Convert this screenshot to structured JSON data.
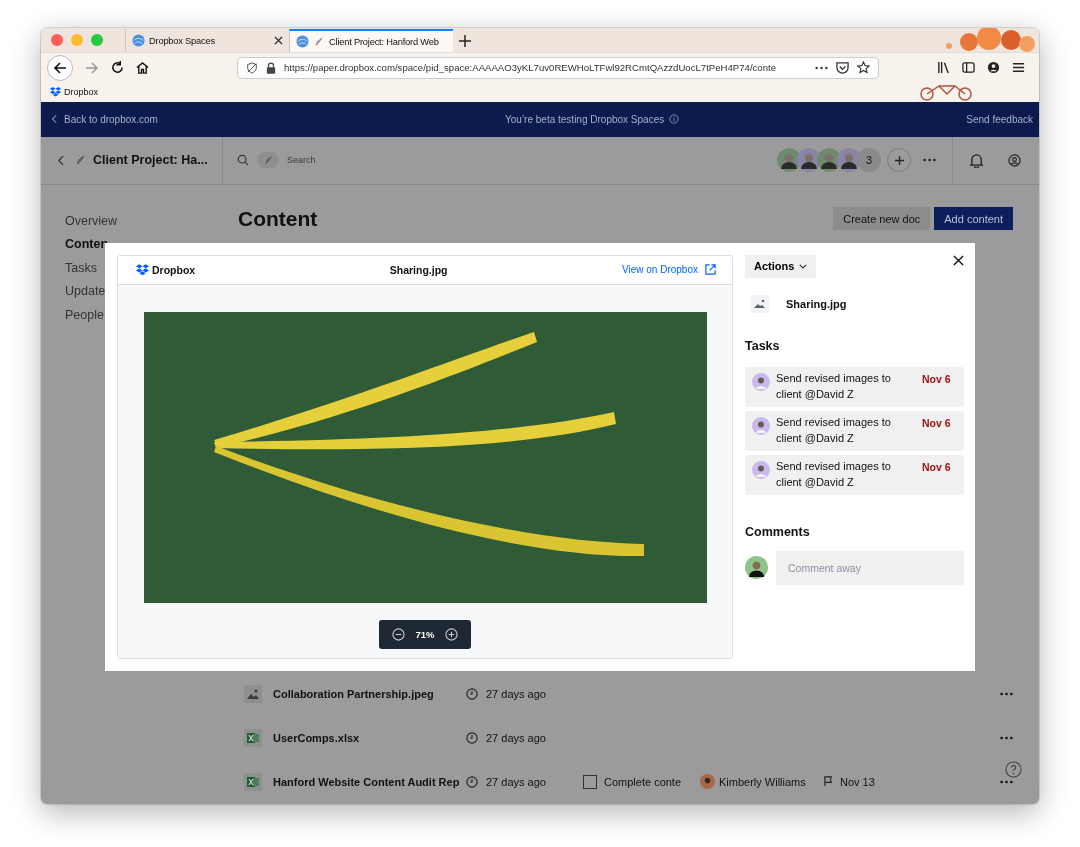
{
  "browser": {
    "tabs": [
      {
        "title": "Dropbox Spaces",
        "selected": false
      },
      {
        "title": "Client Project: Hanford Web",
        "selected": true
      }
    ],
    "url": "https://paper.dropbox.com/space/pid_space:AAAAAO3yKL7uv0REWHoLTFwl92RCmtQAzzdUocL7tPeH4P74/conte",
    "bookmarks": [
      "Dropbox"
    ]
  },
  "banner": {
    "back": "Back to dropbox.com",
    "message": "You’re beta testing Dropbox Spaces",
    "feedback": "Send feedback"
  },
  "header": {
    "title": "Client Project: Ha...",
    "search": {
      "placeholder": "Search"
    },
    "member_count": "3"
  },
  "sidebar": {
    "items": [
      {
        "label": "Overview",
        "selected": false
      },
      {
        "label": "Conten",
        "selected": true
      },
      {
        "label": "Tasks",
        "selected": false
      },
      {
        "label": "Update",
        "selected": false
      },
      {
        "label": "People",
        "selected": false
      }
    ]
  },
  "content": {
    "title": "Content",
    "buttons": [
      {
        "label": "Create new doc",
        "kind": "secondary"
      },
      {
        "label": "Add content",
        "kind": "primary"
      }
    ],
    "rows": [
      {
        "kind": "image",
        "name": "Collaboration Partnership.jpeg",
        "modified": "27 days ago"
      },
      {
        "kind": "sheet",
        "name": "UserComps.xlsx",
        "modified": "27 days ago"
      },
      {
        "kind": "sheet",
        "name": "Hanford Website Content Audit Rep",
        "modified": "27 days ago",
        "task": {
          "label": "Complete conte",
          "checked": false
        },
        "assignee": "Kimberly Williams",
        "due": "Nov 13"
      }
    ]
  },
  "preview": {
    "brand": "Dropbox",
    "file_name": "Sharing.jpg",
    "link": "View on Dropbox",
    "zoom": "71%"
  },
  "details": {
    "actions": "Actions",
    "file_name": "Sharing.jpg",
    "tasks_heading": "Tasks",
    "tasks": [
      {
        "text": "Send revised images to client @David Z",
        "due": "Nov 6"
      },
      {
        "text": "Send revised images to client @David Z",
        "due": "Nov 6"
      },
      {
        "text": "Send revised images to client @David Z",
        "due": "Nov 6"
      }
    ],
    "comments_heading": "Comments",
    "comment": {
      "placeholder": "Comment away"
    }
  }
}
